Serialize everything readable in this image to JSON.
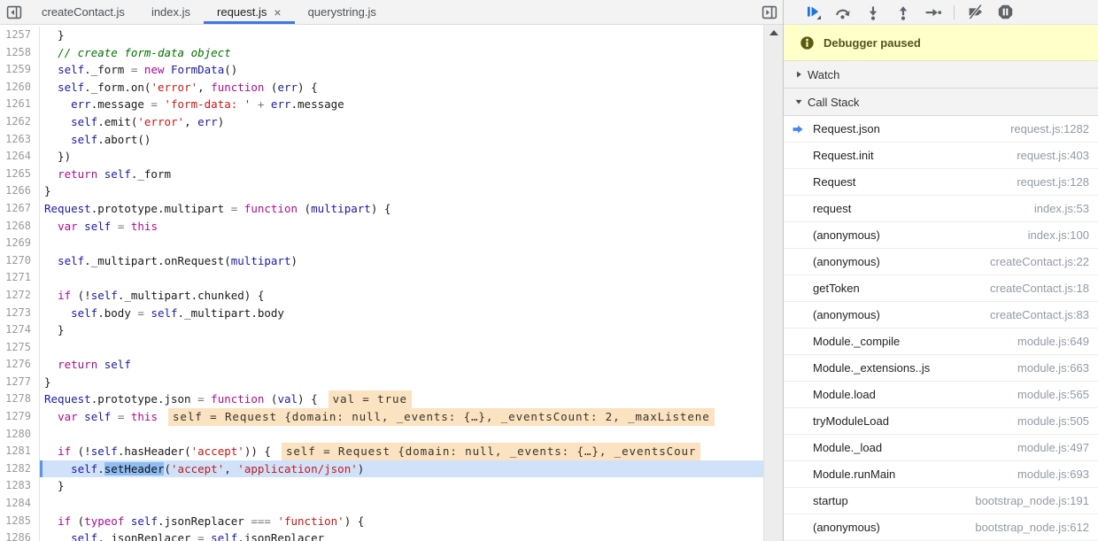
{
  "colors": {
    "accent_blue": "#4285f4",
    "resume_blue": "#1a73e8",
    "icon_gray": "#5f6368",
    "tab_underline": "#4076e3",
    "paused_line_bg": "#d0e2fa",
    "paused_token_bg": "#8ebcf3",
    "hint_bg": "#fbe2c0",
    "banner_bg": "#ffffc9",
    "keyword": "#aa0d91",
    "variable": "#1a1aa6",
    "string": "#c41a16",
    "comment": "#007400"
  },
  "tabbar": {
    "tabs": [
      {
        "label": "createContact.js",
        "active": false
      },
      {
        "label": "index.js",
        "active": false
      },
      {
        "label": "request.js",
        "active": true,
        "close_symbol": "×"
      },
      {
        "label": "querystring.js",
        "active": false
      }
    ]
  },
  "editor": {
    "paused_line": 1282,
    "lines": [
      {
        "n": 1257,
        "t": [
          [
            "p",
            "  }"
          ]
        ]
      },
      {
        "n": 1258,
        "t": [
          [
            "p",
            "  "
          ],
          [
            "c",
            "// create form-data object"
          ]
        ]
      },
      {
        "n": 1259,
        "t": [
          [
            "p",
            "  "
          ],
          [
            "v",
            "self"
          ],
          [
            "p",
            "._form "
          ],
          [
            "o",
            "="
          ],
          [
            "p",
            " "
          ],
          [
            "k",
            "new"
          ],
          [
            "p",
            " "
          ],
          [
            "v",
            "FormData"
          ],
          [
            "p",
            "()"
          ]
        ]
      },
      {
        "n": 1260,
        "t": [
          [
            "p",
            "  "
          ],
          [
            "v",
            "self"
          ],
          [
            "p",
            "._form.on("
          ],
          [
            "s",
            "'error'"
          ],
          [
            "p",
            ", "
          ],
          [
            "k",
            "function"
          ],
          [
            "p",
            " ("
          ],
          [
            "v",
            "err"
          ],
          [
            "p",
            ") {"
          ]
        ]
      },
      {
        "n": 1261,
        "t": [
          [
            "p",
            "    "
          ],
          [
            "v",
            "err"
          ],
          [
            "p",
            ".message "
          ],
          [
            "o",
            "="
          ],
          [
            "p",
            " "
          ],
          [
            "s",
            "'form-data: '"
          ],
          [
            "p",
            " "
          ],
          [
            "o",
            "+"
          ],
          [
            "p",
            " "
          ],
          [
            "v",
            "err"
          ],
          [
            "p",
            ".message"
          ]
        ]
      },
      {
        "n": 1262,
        "t": [
          [
            "p",
            "    "
          ],
          [
            "v",
            "self"
          ],
          [
            "p",
            ".emit("
          ],
          [
            "s",
            "'error'"
          ],
          [
            "p",
            ", "
          ],
          [
            "v",
            "err"
          ],
          [
            "p",
            ")"
          ]
        ]
      },
      {
        "n": 1263,
        "t": [
          [
            "p",
            "    "
          ],
          [
            "v",
            "self"
          ],
          [
            "p",
            ".abort()"
          ]
        ]
      },
      {
        "n": 1264,
        "t": [
          [
            "p",
            "  })"
          ]
        ]
      },
      {
        "n": 1265,
        "t": [
          [
            "p",
            "  "
          ],
          [
            "k",
            "return"
          ],
          [
            "p",
            " "
          ],
          [
            "v",
            "self"
          ],
          [
            "p",
            "._form"
          ]
        ]
      },
      {
        "n": 1266,
        "t": [
          [
            "p",
            "}"
          ]
        ]
      },
      {
        "n": 1267,
        "t": [
          [
            "v",
            "Request"
          ],
          [
            "p",
            ".prototype.multipart "
          ],
          [
            "o",
            "="
          ],
          [
            "p",
            " "
          ],
          [
            "k",
            "function"
          ],
          [
            "p",
            " ("
          ],
          [
            "v",
            "multipart"
          ],
          [
            "p",
            ") {"
          ]
        ]
      },
      {
        "n": 1268,
        "t": [
          [
            "p",
            "  "
          ],
          [
            "k",
            "var"
          ],
          [
            "p",
            " "
          ],
          [
            "v",
            "self"
          ],
          [
            "p",
            " "
          ],
          [
            "o",
            "="
          ],
          [
            "p",
            " "
          ],
          [
            "k",
            "this"
          ]
        ]
      },
      {
        "n": 1269,
        "t": []
      },
      {
        "n": 1270,
        "t": [
          [
            "p",
            "  "
          ],
          [
            "v",
            "self"
          ],
          [
            "p",
            "._multipart.onRequest("
          ],
          [
            "v",
            "multipart"
          ],
          [
            "p",
            ")"
          ]
        ]
      },
      {
        "n": 1271,
        "t": []
      },
      {
        "n": 1272,
        "t": [
          [
            "p",
            "  "
          ],
          [
            "k",
            "if"
          ],
          [
            "p",
            " (!"
          ],
          [
            "v",
            "self"
          ],
          [
            "p",
            "._multipart.chunked) {"
          ]
        ]
      },
      {
        "n": 1273,
        "t": [
          [
            "p",
            "    "
          ],
          [
            "v",
            "self"
          ],
          [
            "p",
            ".body "
          ],
          [
            "o",
            "="
          ],
          [
            "p",
            " "
          ],
          [
            "v",
            "self"
          ],
          [
            "p",
            "._multipart.body"
          ]
        ]
      },
      {
        "n": 1274,
        "t": [
          [
            "p",
            "  }"
          ]
        ]
      },
      {
        "n": 1275,
        "t": []
      },
      {
        "n": 1276,
        "t": [
          [
            "p",
            "  "
          ],
          [
            "k",
            "return"
          ],
          [
            "p",
            " "
          ],
          [
            "v",
            "self"
          ]
        ]
      },
      {
        "n": 1277,
        "t": [
          [
            "p",
            "}"
          ]
        ]
      },
      {
        "n": 1278,
        "t": [
          [
            "v",
            "Request"
          ],
          [
            "p",
            ".prototype.json "
          ],
          [
            "o",
            "="
          ],
          [
            "p",
            " "
          ],
          [
            "k",
            "function"
          ],
          [
            "p",
            " ("
          ],
          [
            "v",
            "val"
          ],
          [
            "p",
            ") {"
          ]
        ],
        "hint": "val = true"
      },
      {
        "n": 1279,
        "t": [
          [
            "p",
            "  "
          ],
          [
            "k",
            "var"
          ],
          [
            "p",
            " "
          ],
          [
            "v",
            "self"
          ],
          [
            "p",
            " "
          ],
          [
            "o",
            "="
          ],
          [
            "p",
            " "
          ],
          [
            "k",
            "this"
          ]
        ],
        "hint": "self = Request {domain: null, _events: {…}, _eventsCount: 2, _maxListene"
      },
      {
        "n": 1280,
        "t": []
      },
      {
        "n": 1281,
        "t": [
          [
            "p",
            "  "
          ],
          [
            "k",
            "if"
          ],
          [
            "p",
            " (!"
          ],
          [
            "v",
            "self"
          ],
          [
            "p",
            ".hasHeader("
          ],
          [
            "s",
            "'accept'"
          ],
          [
            "p",
            ")) {"
          ]
        ],
        "hint": "self = Request {domain: null, _events: {…}, _eventsCour"
      },
      {
        "n": 1282,
        "t": [
          [
            "p",
            "    "
          ],
          [
            "v",
            "self"
          ],
          [
            "p",
            "."
          ],
          [
            "hl",
            "setHeader"
          ],
          [
            "p",
            "("
          ],
          [
            "s",
            "'accept'"
          ],
          [
            "p",
            ", "
          ],
          [
            "s",
            "'application/json'"
          ],
          [
            "p",
            ")"
          ]
        ],
        "paused": true
      },
      {
        "n": 1283,
        "t": [
          [
            "p",
            "  }"
          ]
        ]
      },
      {
        "n": 1284,
        "t": []
      },
      {
        "n": 1285,
        "t": [
          [
            "p",
            "  "
          ],
          [
            "k",
            "if"
          ],
          [
            "p",
            " ("
          ],
          [
            "k",
            "typeof"
          ],
          [
            "p",
            " "
          ],
          [
            "v",
            "self"
          ],
          [
            "p",
            ".jsonReplacer "
          ],
          [
            "o",
            "==="
          ],
          [
            "p",
            " "
          ],
          [
            "s",
            "'function'"
          ],
          [
            "p",
            ") {"
          ]
        ]
      },
      {
        "n": 1286,
        "t": [
          [
            "p",
            "    "
          ],
          [
            "v",
            "self"
          ],
          [
            "p",
            "._jsonReplacer "
          ],
          [
            "o",
            "="
          ],
          [
            "p",
            " "
          ],
          [
            "v",
            "self"
          ],
          [
            "p",
            ".jsonReplacer"
          ]
        ]
      }
    ]
  },
  "debug_toolbar": {
    "buttons": [
      "resume",
      "step-over",
      "step-into",
      "step-out",
      "step",
      "deactivate-breakpoints",
      "pause-on-exceptions"
    ]
  },
  "panel": {
    "banner": {
      "label": "Debugger paused",
      "icon": "info-icon"
    },
    "sections": [
      {
        "label": "Watch",
        "state": "collapsed"
      },
      {
        "label": "Call Stack",
        "state": "expanded"
      }
    ],
    "call_stack": [
      {
        "name": "Request.json",
        "loc": "request.js:1282",
        "current": true
      },
      {
        "name": "Request.init",
        "loc": "request.js:403",
        "current": false
      },
      {
        "name": "Request",
        "loc": "request.js:128",
        "current": false
      },
      {
        "name": "request",
        "loc": "index.js:53",
        "current": false
      },
      {
        "name": "(anonymous)",
        "loc": "index.js:100",
        "current": false
      },
      {
        "name": "(anonymous)",
        "loc": "createContact.js:22",
        "current": false
      },
      {
        "name": "getToken",
        "loc": "createContact.js:18",
        "current": false
      },
      {
        "name": "(anonymous)",
        "loc": "createContact.js:83",
        "current": false
      },
      {
        "name": "Module._compile",
        "loc": "module.js:649",
        "current": false
      },
      {
        "name": "Module._extensions..js",
        "loc": "module.js:663",
        "current": false
      },
      {
        "name": "Module.load",
        "loc": "module.js:565",
        "current": false
      },
      {
        "name": "tryModuleLoad",
        "loc": "module.js:505",
        "current": false
      },
      {
        "name": "Module._load",
        "loc": "module.js:497",
        "current": false
      },
      {
        "name": "Module.runMain",
        "loc": "module.js:693",
        "current": false
      },
      {
        "name": "startup",
        "loc": "bootstrap_node.js:191",
        "current": false
      },
      {
        "name": "(anonymous)",
        "loc": "bootstrap_node.js:612",
        "current": false
      }
    ]
  }
}
